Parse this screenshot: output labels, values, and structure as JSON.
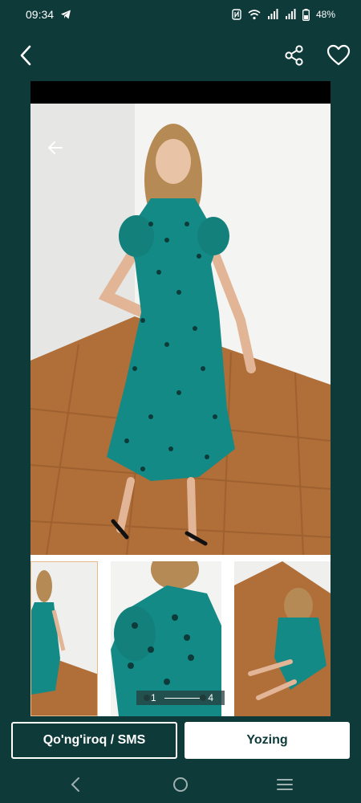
{
  "status_bar": {
    "time": "09:34",
    "battery": "48%",
    "icons": [
      "telegram-icon",
      "nfc-icon",
      "wifi-icon",
      "signal-icon",
      "signal-icon",
      "battery-icon"
    ]
  },
  "top_bar": {
    "icons": [
      "chevron-left-icon",
      "share-icon",
      "heart-icon"
    ]
  },
  "gallery": {
    "current": "1",
    "total": "4",
    "icons": [
      "arrow-left-icon"
    ]
  },
  "actions": {
    "call_label": "Qo'ng'iroq / SMS",
    "write_label": "Yozing"
  },
  "nav_bar": {
    "icons": [
      "back-icon",
      "home-icon",
      "recents-icon"
    ]
  },
  "colors": {
    "background": "#0f3a3a",
    "dress": "#138a86",
    "floor": "#b06e38",
    "accent_white": "#ffffff"
  }
}
